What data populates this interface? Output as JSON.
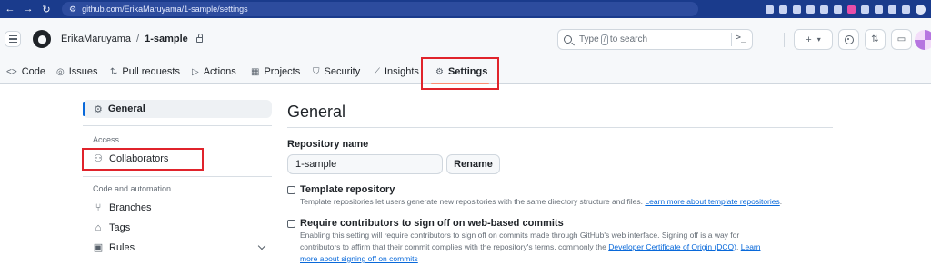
{
  "browser": {
    "url": "github.com/ErikaMaruyama/1-sample/settings"
  },
  "header": {
    "owner": "ErikaMaruyama",
    "separator": "/",
    "repo": "1-sample",
    "search_prefix": "Type",
    "search_key": "/",
    "search_suffix": "to search",
    "command_icon": ">_",
    "plus_label": "+",
    "plus_caret": "▾"
  },
  "tabs": [
    {
      "label": "Code",
      "icon": "<>"
    },
    {
      "label": "Issues",
      "icon": "◎"
    },
    {
      "label": "Pull requests",
      "icon": "⇅"
    },
    {
      "label": "Actions",
      "icon": "▷"
    },
    {
      "label": "Projects",
      "icon": "▦"
    },
    {
      "label": "Security",
      "icon": "⛉"
    },
    {
      "label": "Insights",
      "icon": "⟋"
    },
    {
      "label": "Settings",
      "icon": "⚙"
    }
  ],
  "sidebar": {
    "general": "General",
    "access_heading": "Access",
    "collaborators": "Collaborators",
    "code_heading": "Code and automation",
    "branches": "Branches",
    "tags": "Tags",
    "rules": "Rules"
  },
  "main": {
    "title": "General",
    "repo_name_label": "Repository name",
    "repo_name_value": "1-sample",
    "rename_label": "Rename",
    "template": {
      "label": "Template repository",
      "desc": "Template repositories let users generate new repositories with the same directory structure and files.",
      "link": "Learn more about template repositories",
      "link_suffix": "."
    },
    "signoff": {
      "label": "Require contributors to sign off on web-based commits",
      "desc1": "Enabling this setting will require contributors to sign off on commits made through GitHub's web interface. Signing off is a way for",
      "desc2": "contributors to affirm that their commit complies with the repository's terms, commonly the",
      "link1": "Developer Certificate of Origin (DCO)",
      "link2a": "Learn",
      "link2b": "more about signing off on commits"
    }
  }
}
